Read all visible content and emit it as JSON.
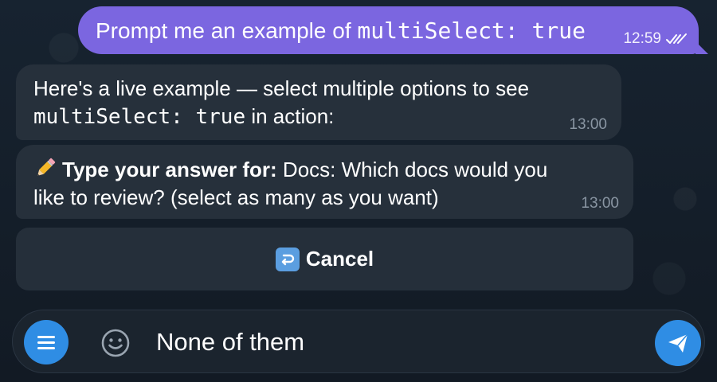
{
  "chat": {
    "outgoing": {
      "text_before": "Prompt me an example of ",
      "code": "multiSelect: true",
      "time": "12:59",
      "status_icon": "double-check-icon"
    },
    "incoming_1": {
      "text_line1": "Here's a live example — select multiple options to see",
      "code": "multiSelect: true",
      "text_after": " in action:",
      "time": "13:00"
    },
    "incoming_2": {
      "icon": "pencil-icon",
      "bold_label": "Type your answer for:",
      "text": " Docs: Which docs would you like to review? (select as many as you want)",
      "time": "13:00"
    }
  },
  "keyboard": {
    "cancel_icon": "return-arrow-icon",
    "cancel_label": "Cancel"
  },
  "composer": {
    "menu_icon": "menu-icon",
    "emoji_icon": "smiley-icon",
    "input_value": "None of them",
    "send_icon": "send-icon"
  },
  "colors": {
    "background": "#15202b",
    "outgoing_bubble": "#7b66e0",
    "incoming_bubble": "#26303b",
    "accent": "#2f8de4"
  }
}
